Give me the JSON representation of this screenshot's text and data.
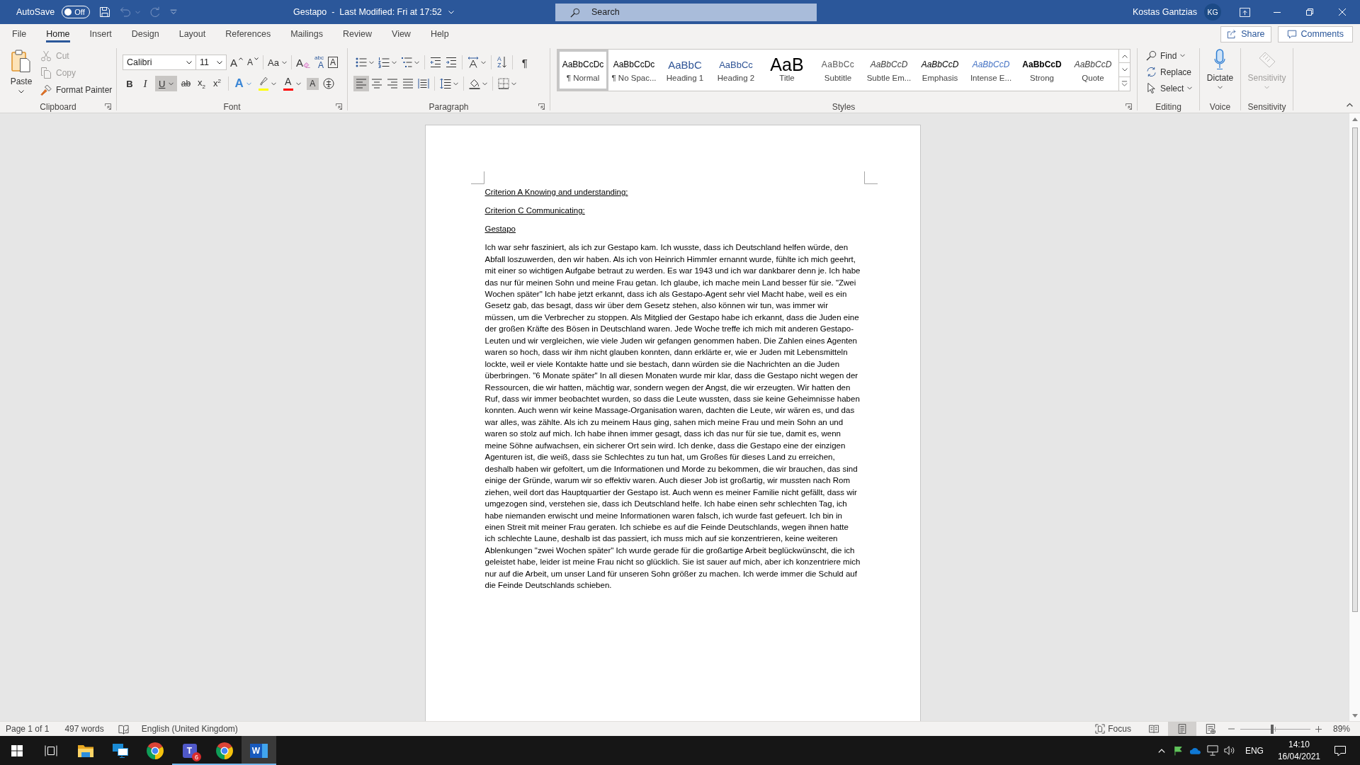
{
  "title_bar": {
    "autosave": {
      "label": "AutoSave",
      "state": "Off",
      "on": false
    },
    "quick_access": [
      {
        "kind": "save",
        "disabled": false
      },
      {
        "kind": "undo",
        "disabled": true
      },
      {
        "kind": "redo",
        "disabled": true
      },
      {
        "kind": "customize",
        "disabled": false
      }
    ],
    "title": "Gestapo  -  Last Modified: Fri at 17:52",
    "search": {
      "placeholder": "Search"
    },
    "user": {
      "name": "Kostas Gantzias",
      "initials": "KG"
    }
  },
  "tabs": [
    {
      "label": "File",
      "selected": false
    },
    {
      "label": "Home",
      "selected": true
    },
    {
      "label": "Insert",
      "selected": false
    },
    {
      "label": "Design",
      "selected": false
    },
    {
      "label": "Layout",
      "selected": false
    },
    {
      "label": "References",
      "selected": false
    },
    {
      "label": "Mailings",
      "selected": false
    },
    {
      "label": "Review",
      "selected": false
    },
    {
      "label": "View",
      "selected": false
    },
    {
      "label": "Help",
      "selected": false
    }
  ],
  "share": {
    "label": "Share"
  },
  "comments": {
    "label": "Comments"
  },
  "ribbon": {
    "clipboard": {
      "label": "Clipboard",
      "paste": "Paste",
      "tools": [
        {
          "kind": "cut",
          "label": "Cut",
          "disabled": true
        },
        {
          "kind": "copy",
          "label": "Copy",
          "disabled": true
        },
        {
          "kind": "painter",
          "label": "Format Painter",
          "disabled": false
        }
      ]
    },
    "font": {
      "label": "Font",
      "font_name": "Calibri",
      "font_size": "11",
      "tools": [
        {
          "kind": "grow",
          "label": "A"
        },
        {
          "kind": "shrink",
          "label": "A"
        },
        {
          "kind": "case",
          "label": "Aa"
        },
        {
          "kind": "clear",
          "label": "A"
        },
        {
          "kind": "phonetic",
          "label": "A",
          "label_2": "abc"
        },
        {
          "kind": "border",
          "label": "A"
        }
      ],
      "formats": [
        {
          "kind": "bold",
          "label": "B",
          "on": false
        },
        {
          "kind": "italic",
          "label": "I",
          "on": false
        },
        {
          "kind": "underline",
          "label": "U",
          "on": true
        },
        {
          "kind": "strike",
          "label": "ab",
          "on": false
        },
        {
          "kind": "subscript",
          "label": "x$_{2}$",
          "on": false
        },
        {
          "kind": "superscript",
          "label": "x$^{2}$",
          "on": false
        }
      ],
      "colors": [
        {
          "kind": "effects",
          "label": "A"
        },
        {
          "kind": "highlight",
          "color": "#ffff00"
        },
        {
          "kind": "font_color",
          "label": "A",
          "color": "#ff0000"
        },
        {
          "kind": "shading",
          "label": "A"
        },
        {
          "kind": "enclose"
        }
      ]
    },
    "paragraph": {
      "label": "Paragraph",
      "tools": [
        {
          "kind": "bullets"
        },
        {
          "kind": "numbering"
        },
        {
          "kind": "multilevel"
        },
        {
          "kind": "decrease"
        },
        {
          "kind": "increase"
        },
        {
          "kind": "direction"
        },
        {
          "kind": "sort",
          "label": "A",
          "label_2": "Z"
        },
        {
          "kind": "pilcrow",
          "label": "¶",
          "on": false
        }
      ],
      "alignments": [
        {
          "kind": "left",
          "selected": true
        },
        {
          "kind": "center",
          "selected": false
        },
        {
          "kind": "right",
          "selected": false
        },
        {
          "kind": "justify",
          "selected": false
        },
        {
          "kind": "distributed",
          "selected": false
        }
      ],
      "spacing": [
        {
          "kind": "line_spacing"
        },
        {
          "kind": "shading"
        },
        {
          "kind": "borders"
        }
      ]
    },
    "styles": {
      "label": "Styles",
      "items": [
        {
          "kind": "normal",
          "preview": "AaBbCcDc",
          "name": "¶ Normal",
          "selected": true
        },
        {
          "kind": "no_spacing",
          "preview": "AaBbCcDc",
          "name": "¶ No Spac...",
          "selected": false
        },
        {
          "kind": "heading1",
          "preview": "AaBbC",
          "name": "Heading 1",
          "selected": false
        },
        {
          "kind": "heading2",
          "preview": "AaBbCc",
          "name": "Heading 2",
          "selected": false
        },
        {
          "kind": "title",
          "preview": "AaB",
          "name": "Title",
          "selected": false
        },
        {
          "kind": "subtitle",
          "preview": "AaBbCc",
          "name": "Subtitle",
          "selected": false
        },
        {
          "kind": "subtle_emphasis",
          "preview": "AaBbCcD",
          "name": "Subtle Em...",
          "selected": false
        },
        {
          "kind": "emphasis",
          "preview": "AaBbCcD",
          "name": "Emphasis",
          "selected": false
        },
        {
          "kind": "intense_emphasis",
          "preview": "AaBbCcD",
          "name": "Intense E...",
          "selected": false
        },
        {
          "kind": "strong",
          "preview": "AaBbCcD",
          "name": "Strong",
          "selected": false
        },
        {
          "kind": "quote",
          "preview": "AaBbCcD",
          "name": "Quote",
          "selected": false
        }
      ]
    },
    "editing": {
      "label": "Editing",
      "items": [
        {
          "kind": "find",
          "label": "Find"
        },
        {
          "kind": "replace",
          "label": "Replace"
        },
        {
          "kind": "select",
          "label": "Select"
        }
      ]
    },
    "voice": {
      "label": "Voice",
      "button": "Dictate"
    },
    "sensitivity": {
      "label": "Sensitivity",
      "button": "Sensitivity",
      "disabled": true
    }
  },
  "document": {
    "headings": [
      "Criterion A Knowing and understanding:",
      "Criterion C Communicating:",
      "Gestapo"
    ],
    "body": "Ich war sehr fasziniert, als ich zur Gestapo kam. Ich wusste, dass ich Deutschland helfen würde, den Abfall loszuwerden, den wir haben. Als ich von Heinrich Himmler ernannt wurde, fühlte ich mich geehrt, mit einer so wichtigen Aufgabe betraut zu werden. Es war 1943 und ich war dankbarer denn je. Ich habe das nur für meinen Sohn und meine Frau getan. Ich glaube, ich mache mein Land besser für sie. \"Zwei Wochen später\" Ich habe jetzt erkannt, dass ich als Gestapo-Agent sehr viel Macht habe, weil es ein Gesetz gab, das besagt, dass wir über dem Gesetz stehen, also können wir tun, was immer wir müssen, um die Verbrecher zu stoppen. Als Mitglied der Gestapo habe ich erkannt, dass die Juden eine der großen Kräfte des Bösen in Deutschland waren. Jede Woche treffe ich mich mit anderen Gestapo-Leuten und wir vergleichen, wie viele Juden wir gefangen genommen haben. Die Zahlen eines Agenten waren so hoch, dass wir ihm nicht glauben konnten, dann erklärte er, wie er Juden mit Lebensmitteln lockte, weil er viele Kontakte hatte und sie bestach, dann würden sie die Nachrichten an die Juden überbringen. \"6 Monate später\" In all diesen Monaten wurde mir klar, dass die Gestapo nicht wegen der Ressourcen, die wir hatten, mächtig war, sondern wegen der Angst, die wir erzeugten. Wir hatten den Ruf, dass wir immer beobachtet wurden, so dass die Leute wussten, dass sie keine Geheimnisse haben konnten. Auch wenn wir keine Massage-Organisation waren, dachten die Leute, wir wären es, und das war alles, was zählte. Als ich zu meinem Haus ging, sahen mich meine Frau und mein Sohn an und waren so stolz auf mich. Ich habe ihnen immer gesagt, dass ich das nur für sie tue, damit es, wenn meine Söhne aufwachsen, ein sicherer Ort sein wird. Ich denke, dass die Gestapo eine der einzigen Agenturen ist, die weiß, dass sie Schlechtes zu tun hat, um Großes für dieses Land zu erreichen, deshalb haben wir gefoltert, um die Informationen und Morde zu bekommen, die wir brauchen, das sind einige der Gründe, warum wir so effektiv waren. Auch dieser Job ist großartig, wir mussten nach Rom ziehen, weil dort das Hauptquartier der Gestapo ist. Auch wenn es meiner Familie nicht gefällt, dass wir umgezogen sind, verstehen sie, dass ich Deutschland helfe. Ich habe einen sehr schlechten Tag, ich habe niemanden erwischt und meine Informationen waren falsch, ich wurde fast gefeuert. Ich bin in einen Streit mit meiner Frau geraten. Ich schiebe es auf die Feinde Deutschlands, wegen ihnen hatte ich schlechte Laune, deshalb ist das passiert, ich muss mich auf sie konzentrieren, keine weiteren Ablenkungen \"zwei Wochen später\" Ich wurde gerade für die großartige Arbeit beglückwünscht, die ich geleistet habe, leider ist meine Frau nicht so glücklich. Sie ist sauer auf mich, aber ich konzentriere mich nur auf die Arbeit, um unser Land für unseren Sohn größer zu machen. Ich werde immer die Schuld auf die Feinde Deutschlands schieben."
  },
  "status_bar": {
    "page": "Page 1 of 1",
    "words": "497 words",
    "language": "English (United Kingdom)",
    "focus": "Focus",
    "views": [
      {
        "kind": "read",
        "selected": false
      },
      {
        "kind": "print",
        "selected": true
      },
      {
        "kind": "web",
        "selected": false
      }
    ],
    "zoom": {
      "level": 0.45,
      "reading": "89%"
    }
  },
  "taskbar": {
    "apps": [
      {
        "kind": "folder",
        "running": false,
        "active": false
      },
      {
        "kind": "remote",
        "running": false,
        "active": false
      },
      {
        "kind": "browser",
        "running": false,
        "active": false
      },
      {
        "kind": "teams",
        "label": "T",
        "badge": "6",
        "running": true,
        "active": false
      },
      {
        "kind": "browser",
        "running": true,
        "active": false
      },
      {
        "kind": "word",
        "label": "W",
        "running": true,
        "active": true
      }
    ],
    "tray": {
      "language": "ENG",
      "time": "14:10",
      "date": "16/04/2021"
    }
  }
}
